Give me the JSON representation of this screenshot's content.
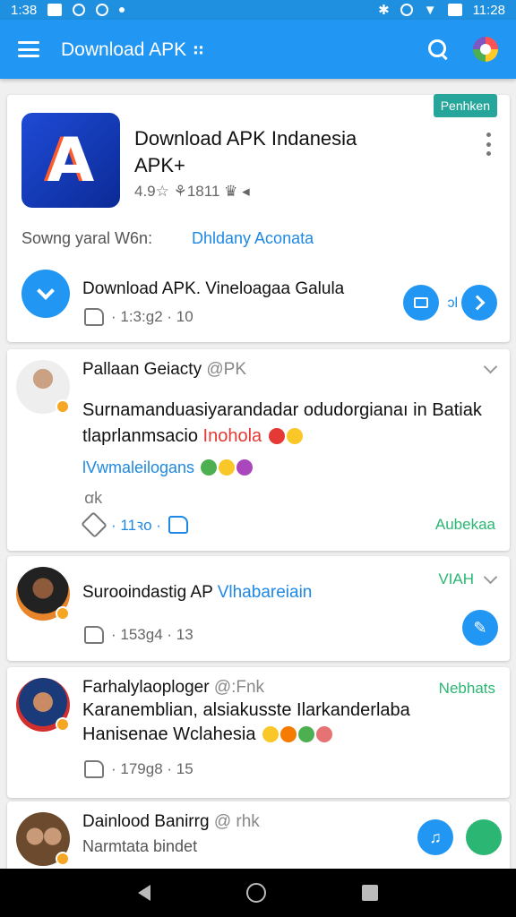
{
  "status_bar": {
    "time_left": "1:38",
    "time_right": "11:28"
  },
  "app_bar": {
    "title": "Download APK ⠶"
  },
  "app_card": {
    "icon_glyph": "A",
    "title": "Download APK Indanesia APK+",
    "meta": "4.9☆ ⚘1811 ♛ ◂",
    "badge": "Penhken",
    "row2_label": "Sowng yaral W6n:",
    "row2_link": "Dhldany Aconata",
    "download_text": "Download APK. Vineloagaa Galula",
    "like_count": "· 1:3:g2 · 10",
    "tag": "ɔl"
  },
  "posts": [
    {
      "name": "Pallaan Geiacty",
      "handle": "@PK",
      "line1": "Surnamanduasiyarandadar odudorgianaı in Batiak",
      "line2_a": "tlaprlanmsacio ",
      "line2_red": "Inohola",
      "link": "lVwmaleilogans",
      "sym": "ꭤk",
      "like_count": "· 11ꝛo ·",
      "action": "Aubekaa"
    },
    {
      "name": "Surooindastig AP",
      "link": "Vlhabareiain",
      "action": "VIAH",
      "like_count": "· 153g4 · 13"
    },
    {
      "name": "Farhalylaoploger",
      "handle": "@:Fnk",
      "line1": "Karanemblian, alsiakusste Ilarkanderlaba",
      "line2": "Hanisenae Wclahesia",
      "action": "Nebhats",
      "like_count": "· 179g8 · 15"
    },
    {
      "name": "Dainlood Banirrg",
      "handle": "@ rhk",
      "line1": "Narmtata bindet"
    }
  ]
}
